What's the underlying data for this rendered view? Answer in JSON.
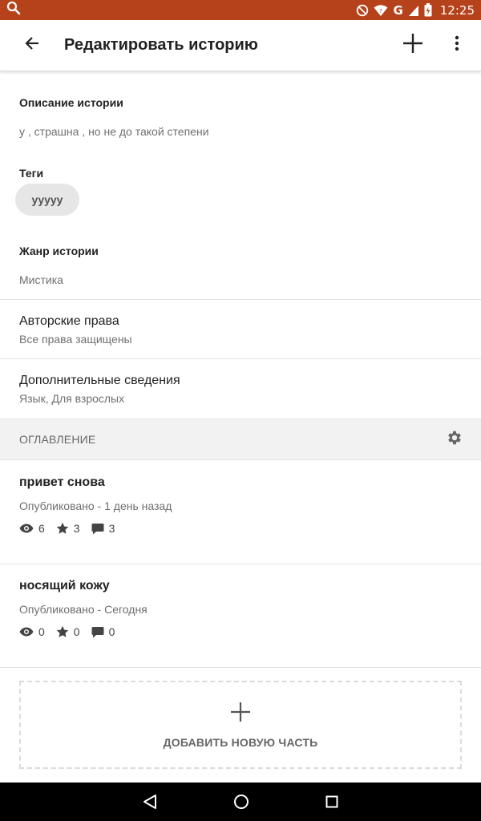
{
  "status_bar": {
    "time": "12:25",
    "network": "G",
    "icons": [
      "search-icon",
      "do-not-disturb-icon",
      "wifi-icon",
      "signal-icon",
      "battery-icon"
    ]
  },
  "app_bar": {
    "title": "Редактировать историю",
    "icons": [
      "back-arrow-icon",
      "add-icon",
      "more-vert-icon"
    ]
  },
  "story": {
    "description_label": "Описание истории",
    "description_value": "у , страшна , но не до такой степени",
    "tags_label": "Теги",
    "tags": [
      "ууууу"
    ],
    "genre_label": "Жанр истории",
    "genre_value": "Мистика"
  },
  "copyright": {
    "title": "Авторские права",
    "subtitle": "Все права защищены"
  },
  "extra_info": {
    "title": "Дополнительные сведения",
    "subtitle": "Язык, Для взрослых"
  },
  "toc": {
    "title": "ОГЛАВЛЕНИЕ",
    "settings_icon": "gear-icon"
  },
  "parts": [
    {
      "title": "привет снова",
      "status": "Опубликовано - 1 день назад",
      "views": "6",
      "votes": "3",
      "comments": "3"
    },
    {
      "title": "носящий кожу",
      "status": "Опубликовано - Сегодня",
      "views": "0",
      "votes": "0",
      "comments": "0"
    }
  ],
  "add_part": {
    "label": "ДОБАВИТЬ НОВУЮ ЧАСТЬ",
    "icon": "plus-icon"
  },
  "colors": {
    "status_bar": "#b5421b",
    "nav_bar": "#000000",
    "section_bg": "#f3f2f2"
  }
}
